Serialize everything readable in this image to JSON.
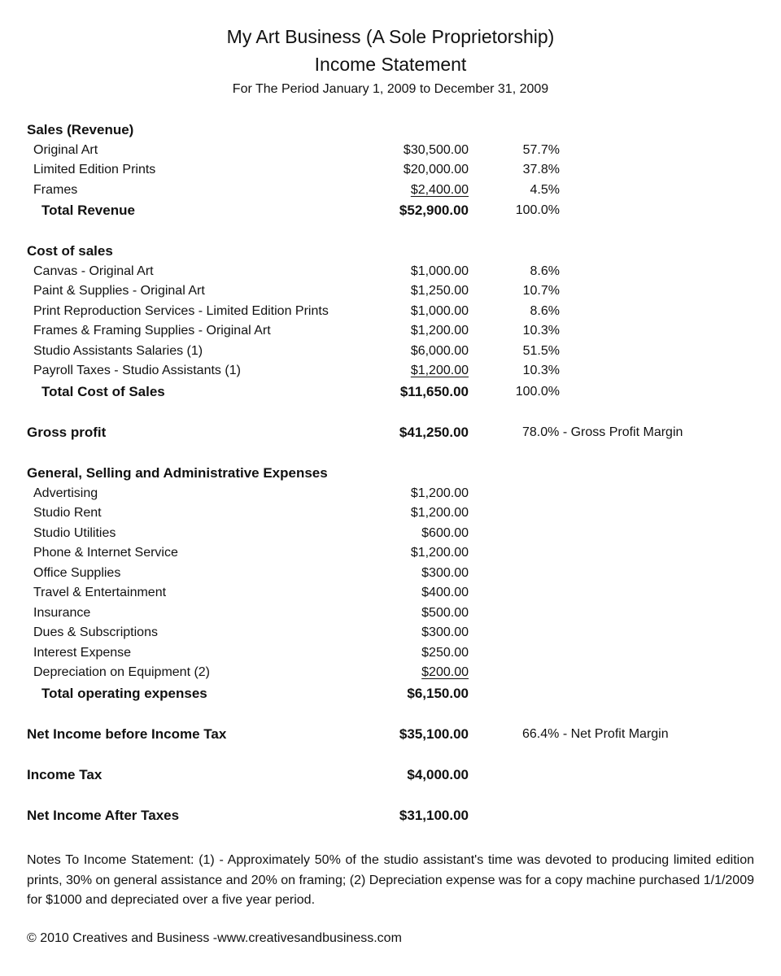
{
  "header": {
    "title": "My Art Business (A Sole Proprietorship)",
    "subtitle": "Income Statement",
    "period": "For The Period January 1, 2009 to December 31, 2009"
  },
  "revenue": {
    "heading": "Sales (Revenue)",
    "items": [
      {
        "label": "Original Art",
        "amount": "$30,500.00",
        "percent": "57.7%"
      },
      {
        "label": "Limited Edition Prints",
        "amount": "$20,000.00",
        "percent": "37.8%"
      },
      {
        "label": "Frames",
        "amount": "$2,400.00",
        "percent": "4.5%"
      }
    ],
    "total": {
      "label": "Total Revenue",
      "amount": "$52,900.00",
      "percent": "100.0%"
    }
  },
  "cost_of_sales": {
    "heading": "Cost of sales",
    "items": [
      {
        "label": "Canvas - Original Art",
        "amount": "$1,000.00",
        "percent": "8.6%"
      },
      {
        "label": "Paint & Supplies - Original Art",
        "amount": "$1,250.00",
        "percent": "10.7%"
      },
      {
        "label": "Print Reproduction Services - Limited Edition Prints",
        "amount": "$1,000.00",
        "percent": "8.6%"
      },
      {
        "label": "Frames & Framing Supplies - Original Art",
        "amount": "$1,200.00",
        "percent": "10.3%"
      },
      {
        "label": "Studio Assistants Salaries (1)",
        "amount": "$6,000.00",
        "percent": "51.5%"
      },
      {
        "label": "Payroll Taxes - Studio Assistants (1)",
        "amount": "$1,200.00",
        "percent": "10.3%"
      }
    ],
    "total": {
      "label": "Total Cost of Sales",
      "amount": "$11,650.00",
      "percent": "100.0%"
    }
  },
  "gross_profit": {
    "label": "Gross profit",
    "amount": "$41,250.00",
    "note": "78.0%  - Gross Profit Margin"
  },
  "expenses": {
    "heading": "General, Selling and Administrative Expenses",
    "items": [
      {
        "label": "Advertising",
        "amount": "$1,200.00"
      },
      {
        "label": "Studio Rent",
        "amount": "$1,200.00"
      },
      {
        "label": "Studio Utilities",
        "amount": "$600.00"
      },
      {
        "label": "Phone & Internet Service",
        "amount": "$1,200.00"
      },
      {
        "label": "Office Supplies",
        "amount": "$300.00"
      },
      {
        "label": "Travel & Entertainment",
        "amount": "$400.00"
      },
      {
        "label": "Insurance",
        "amount": "$500.00"
      },
      {
        "label": "Dues & Subscriptions",
        "amount": "$300.00"
      },
      {
        "label": "Interest Expense",
        "amount": "$250.00"
      },
      {
        "label": "Depreciation on Equipment (2)",
        "amount": "$200.00"
      }
    ],
    "total": {
      "label": "Total operating expenses",
      "amount": "$6,150.00"
    }
  },
  "net_before_tax": {
    "label": "Net Income before Income Tax",
    "amount": "$35,100.00",
    "note": "66.4%  - Net Profit Margin"
  },
  "income_tax": {
    "label": "Income Tax",
    "amount": "$4,000.00"
  },
  "net_after_tax": {
    "label": "Net Income After Taxes",
    "amount": "$31,100.00"
  },
  "notes": "Notes To Income Statement: (1) - Approximately 50% of the studio assistant's time was devoted to producing limited edition prints, 30% on general assistance and 20% on framing; (2) Depreciation expense was for a copy machine purchased 1/1/2009 for $1000 and depreciated over a five year period.",
  "copyright": "© 2010 Creatives and Business -www.creativesandbusiness.com"
}
